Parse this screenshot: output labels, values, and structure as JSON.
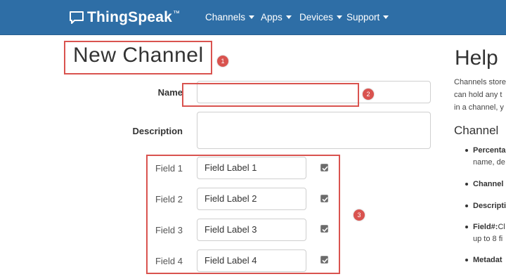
{
  "navbar": {
    "brand": "ThingSpeak",
    "brand_tm": "™",
    "menu": [
      {
        "label": "Channels"
      },
      {
        "label": "Apps"
      },
      {
        "label": "Devices"
      },
      {
        "label": "Support"
      }
    ]
  },
  "form": {
    "title": "New Channel",
    "name_label": "Name",
    "name_value": "",
    "description_label": "Description",
    "description_value": "",
    "fields": [
      {
        "label": "Field 1",
        "value": "Field Label 1",
        "checked": true
      },
      {
        "label": "Field 2",
        "value": "Field Label 2",
        "checked": true
      },
      {
        "label": "Field 3",
        "value": "Field Label 3",
        "checked": true
      },
      {
        "label": "Field 4",
        "value": "Field Label 4",
        "checked": true
      }
    ]
  },
  "annotations": [
    "1",
    "2",
    "3"
  ],
  "help": {
    "title": "Help",
    "intro": [
      "Channels store",
      "can hold any t",
      "in a channel, y"
    ],
    "subtitle": "Channel",
    "bullets": [
      {
        "term": "Percenta",
        "cont": "name, de"
      },
      {
        "term": "Channel",
        "cont": ""
      },
      {
        "term": "Descripti",
        "cont": ""
      },
      {
        "term": "Field#:",
        "rest": " Cl",
        "cont": "up to 8 fi"
      },
      {
        "term": "Metadat",
        "cont": ""
      }
    ]
  },
  "colors": {
    "navbar": "#2e6ea6",
    "annotation": "#d9534f"
  }
}
